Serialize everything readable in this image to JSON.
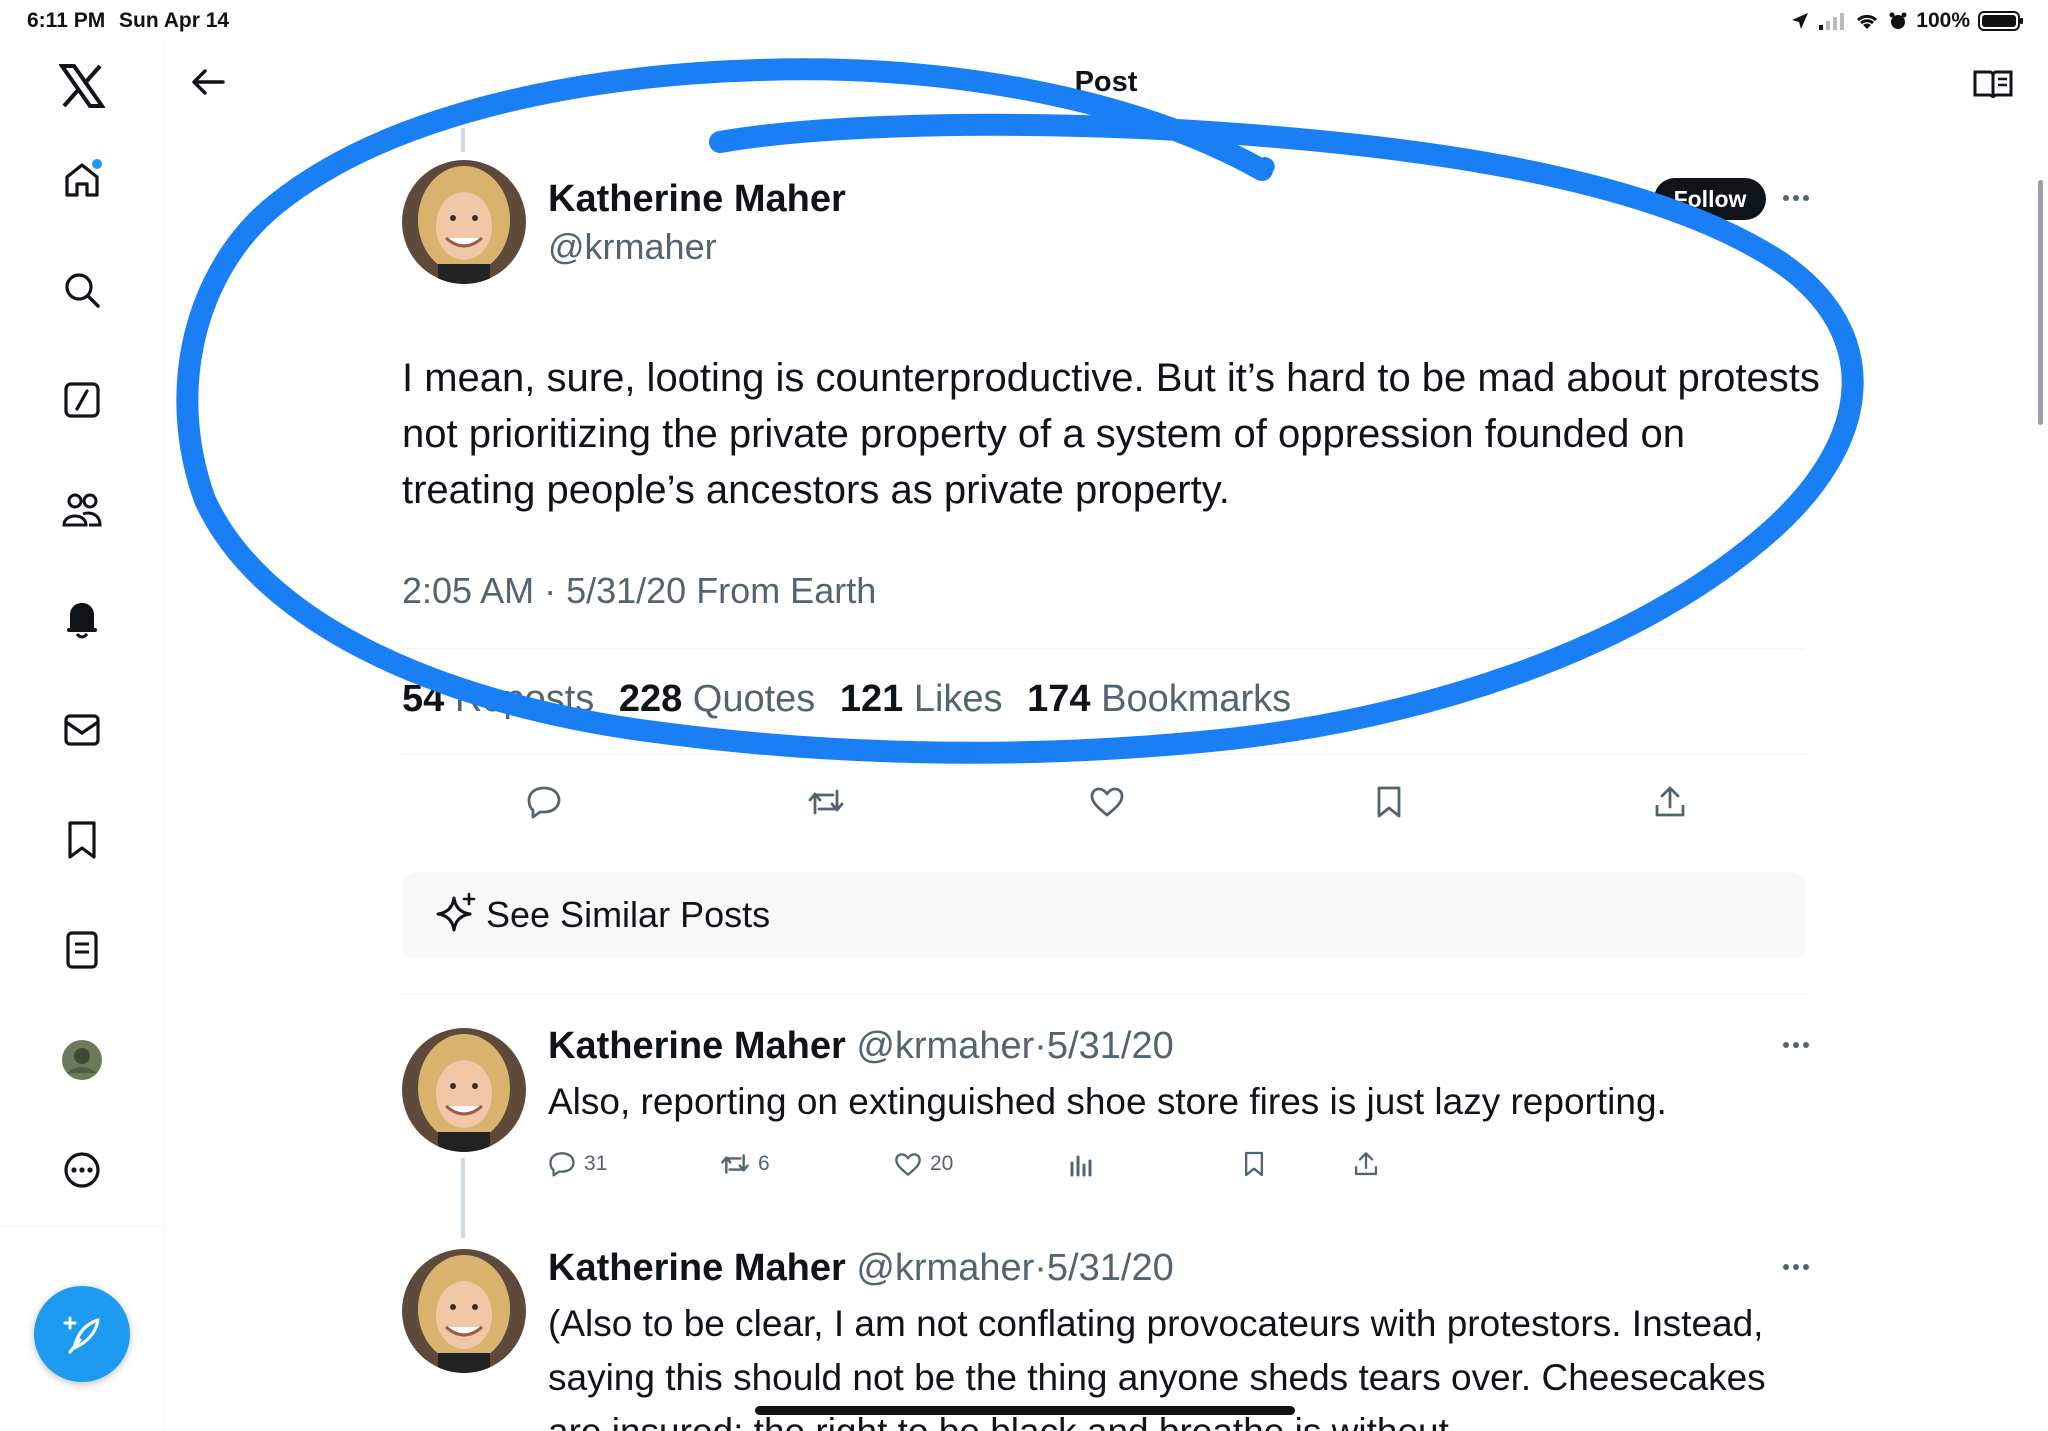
{
  "status_bar": {
    "time": "6:11 PM",
    "date": "Sun Apr 14",
    "battery": "100%"
  },
  "header": {
    "title": "Post"
  },
  "post": {
    "author_name": "Katherine Maher",
    "author_handle": "@krmaher",
    "follow_label": "Follow",
    "text": "I mean, sure, looting is counterproductive. But it’s hard to be mad about protests not prioritizing the private property of a system of oppression founded on treating people’s ancestors as private property.",
    "meta": "2:05 AM · 5/31/20 From Earth",
    "stats": {
      "reposts_count": "54",
      "reposts_label": "Reposts",
      "quotes_count": "228",
      "quotes_label": "Quotes",
      "likes_count": "121",
      "likes_label": "Likes",
      "bookmarks_count": "174",
      "bookmarks_label": "Bookmarks"
    }
  },
  "similar": {
    "label": "See Similar Posts"
  },
  "replies": [
    {
      "name": "Katherine Maher",
      "handle": "@krmaher",
      "date": "5/31/20",
      "text": "Also, reporting on extinguished shoe store fires is just lazy reporting.",
      "replies": "31",
      "reposts": "6",
      "likes": "20"
    },
    {
      "name": "Katherine Maher",
      "handle": "@krmaher",
      "date": "5/31/20",
      "text": "(Also to be clear, I am not conflating provocateurs with protestors. Instead, saying this should not be the thing anyone sheds tears over. Cheesecakes are insured; the right to be black and breathe is without"
    }
  ],
  "colors": {
    "accent": "#1d9bf0",
    "annotation": "#1a7ff5",
    "text": "#0f1419",
    "secondary": "#536471"
  }
}
